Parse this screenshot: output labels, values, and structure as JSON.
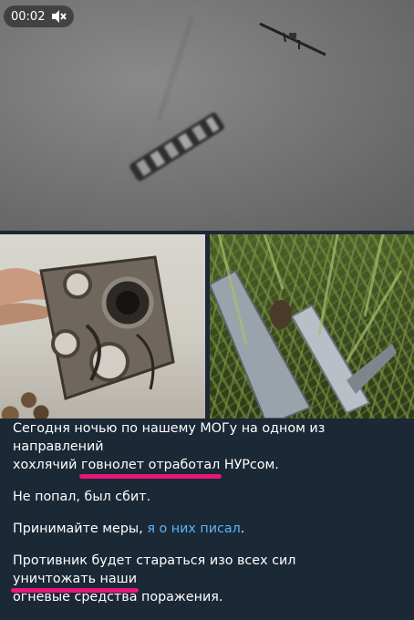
{
  "video": {
    "timestamp": "00:02",
    "mute_icon": "speaker-muted-icon"
  },
  "photos": [
    {
      "name": "wreckage-photo"
    },
    {
      "name": "grass-debris-photo"
    }
  ],
  "message": {
    "line1": "Сегодня ночью по нашему МОГу на одном из направлений",
    "line2_pre": "хохлячий ",
    "line2_hl": "говнолет отработал",
    "line2_post": " НУРсом.",
    "para2": "Не попал, был сбит.",
    "para3_pre": "Принимайте меры, ",
    "para3_link": "я о них писал",
    "para3_post": ".",
    "para4_pre": "Противник будет стараться изо всех сил ",
    "para4_hl": "уничтожать наши",
    "para4_line2": "огневые средства поражения."
  },
  "colors": {
    "background": "#1b2836",
    "text": "#ffffff",
    "link": "#5eb5f7",
    "highlight": "#e8167a"
  }
}
